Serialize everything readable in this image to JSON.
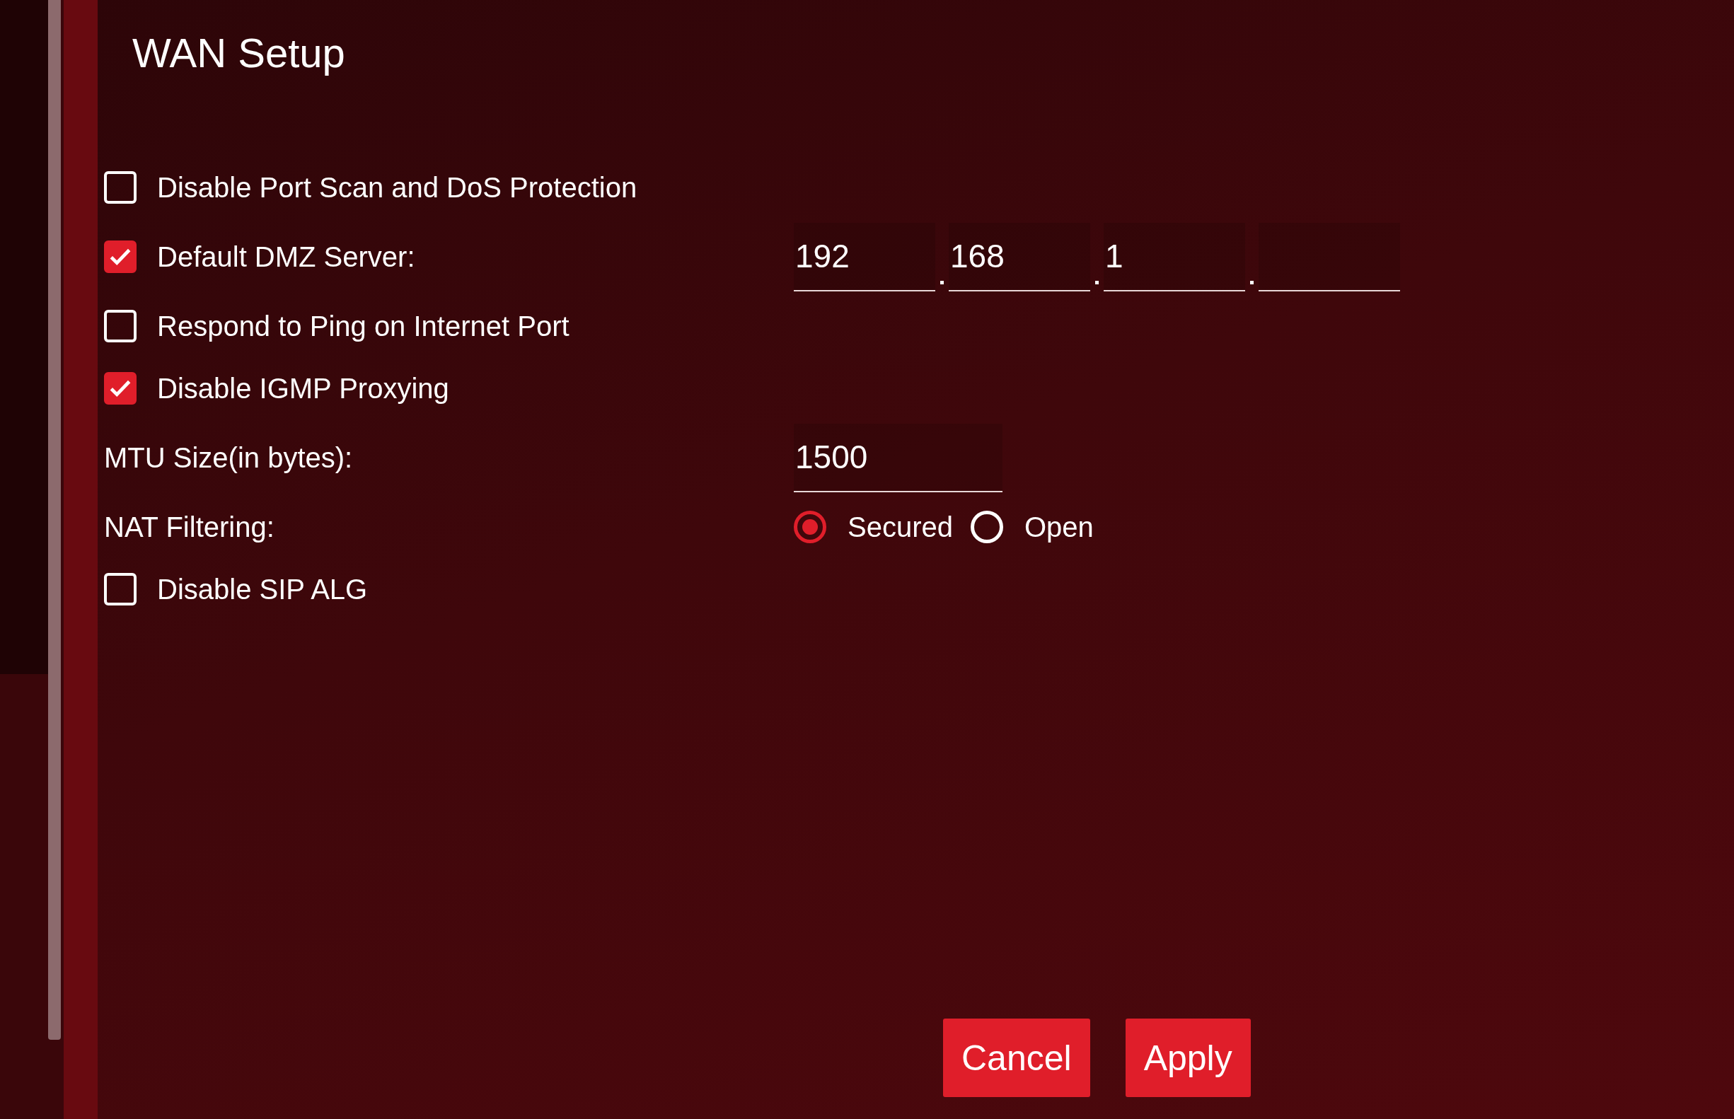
{
  "title": "WAN Setup",
  "rows": [
    {
      "kind": "checkbox",
      "label": "Disable Port Scan and DoS Protection",
      "checked": false
    },
    {
      "kind": "checkbox",
      "label": "Default DMZ Server:",
      "checked": true,
      "ip": [
        "192",
        "168",
        "1"
      ]
    },
    {
      "kind": "checkbox",
      "label": "Respond to Ping on Internet Port",
      "checked": false
    },
    {
      "kind": "checkbox",
      "label": "Disable IGMP Proxying",
      "checked": true
    },
    {
      "kind": "field",
      "label": "MTU Size(in bytes):",
      "value": "1500"
    },
    {
      "kind": "radio",
      "label": "NAT Filtering:",
      "options": [
        {
          "label": "Secured",
          "selected": true
        },
        {
          "label": "Open",
          "selected": false
        }
      ]
    },
    {
      "kind": "checkbox",
      "label": "Disable SIP ALG",
      "checked": false
    }
  ],
  "buttons": [
    {
      "label": "Cancel"
    },
    {
      "label": "Apply"
    }
  ]
}
